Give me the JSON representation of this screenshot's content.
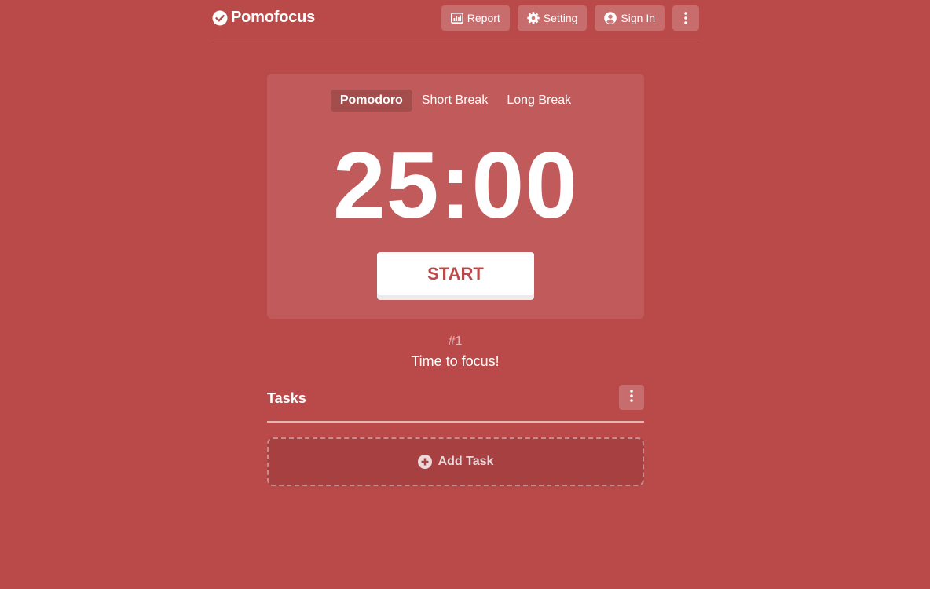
{
  "app": {
    "name": "Pomofocus",
    "logo_icon": "check-circle-icon",
    "theme_color": "#ba4949"
  },
  "header": {
    "report_label": "Report",
    "setting_label": "Setting",
    "signin_label": "Sign In",
    "report_icon": "bar-chart-icon",
    "setting_icon": "gear-icon",
    "signin_icon": "user-circle-icon",
    "menu_icon": "vertical-dots-icon"
  },
  "timer": {
    "tabs": [
      {
        "label": "Pomodoro",
        "active": true
      },
      {
        "label": "Short Break",
        "active": false
      },
      {
        "label": "Long Break",
        "active": false
      }
    ],
    "time": "25:00",
    "start_label": "START"
  },
  "session": {
    "number": "#1",
    "message": "Time to focus!"
  },
  "tasks": {
    "title": "Tasks",
    "menu_icon": "vertical-dots-icon",
    "add_label": "Add Task",
    "add_icon": "plus-circle-icon"
  }
}
